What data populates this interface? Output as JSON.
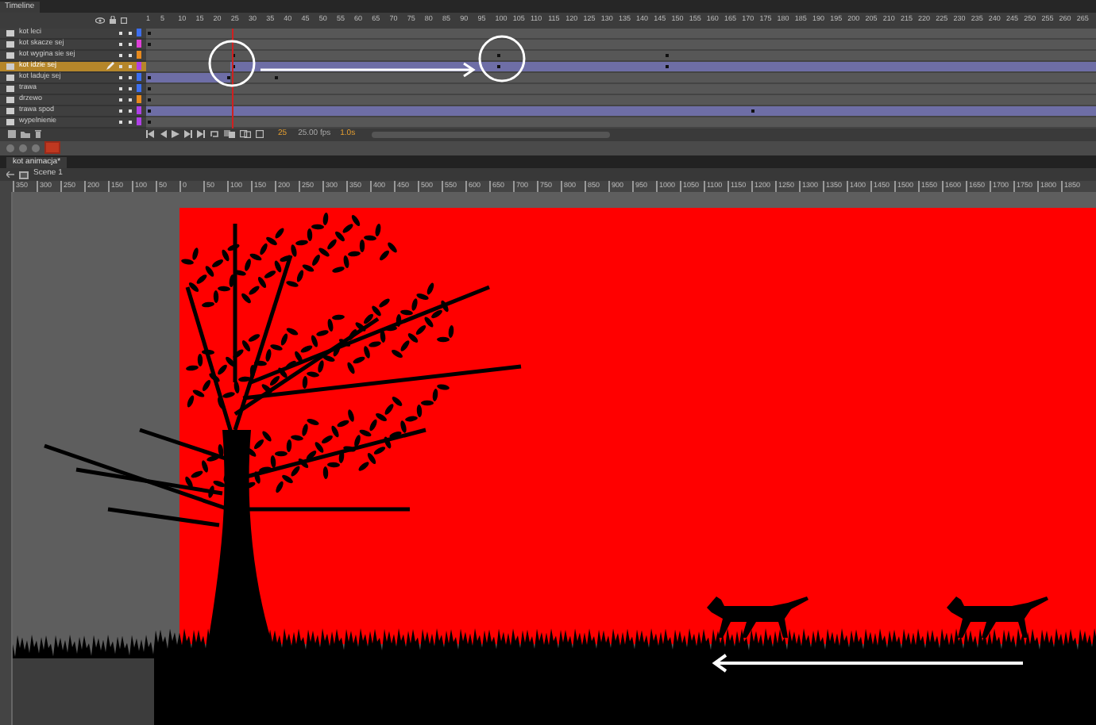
{
  "timeline": {
    "title": "Timeline",
    "frame_ruler": [
      "1",
      "5",
      "10",
      "15",
      "20",
      "25",
      "30",
      "35",
      "40",
      "45",
      "50",
      "55",
      "60",
      "65",
      "70",
      "75",
      "80",
      "85",
      "90",
      "95",
      "100",
      "105",
      "110",
      "115",
      "120",
      "125",
      "130",
      "135",
      "140",
      "145",
      "150",
      "155",
      "160",
      "165",
      "170",
      "175",
      "180",
      "185",
      "190",
      "195",
      "200",
      "205",
      "210",
      "215",
      "220",
      "225",
      "230",
      "235",
      "240",
      "245",
      "250",
      "255",
      "260",
      "265"
    ],
    "layers": [
      {
        "name": "kot leci",
        "color": "#3d6ff0",
        "selected": false,
        "kind": "empty"
      },
      {
        "name": "kot skacze sej",
        "color": "#e040d8",
        "selected": false,
        "kind": "empty"
      },
      {
        "name": "kot wygina sie sej",
        "color": "#e88a1c",
        "selected": false,
        "kind": "keys"
      },
      {
        "name": "kot idzie sej",
        "color": "#b040e8",
        "selected": true,
        "kind": "tween-after"
      },
      {
        "name": "kot laduje sej",
        "color": "#3d6ff0",
        "selected": false,
        "kind": "tween-before"
      },
      {
        "name": "trawa",
        "color": "#3d6ff0",
        "selected": false,
        "kind": "static"
      },
      {
        "name": "drzewo",
        "color": "#e88a1c",
        "selected": false,
        "kind": "static"
      },
      {
        "name": "trawa spod",
        "color": "#b040e8",
        "selected": false,
        "kind": "tween-full"
      },
      {
        "name": "wypelnienie",
        "color": "#b040e8",
        "selected": false,
        "kind": "static"
      }
    ],
    "status": {
      "frame": "25",
      "fps": "25.00 fps",
      "time": "1.0s"
    }
  },
  "document": {
    "tab": "kot animacja*",
    "scene": "Scene 1",
    "stage_ruler": [
      "350",
      "300",
      "250",
      "200",
      "150",
      "100",
      "50",
      "0",
      "50",
      "100",
      "150",
      "200",
      "250",
      "300",
      "350",
      "400",
      "450",
      "500",
      "550",
      "600",
      "650",
      "700",
      "750",
      "800",
      "850",
      "900",
      "950",
      "1000",
      "1050",
      "1100",
      "1150",
      "1200",
      "1250",
      "1300",
      "1350",
      "1400",
      "1450",
      "1500",
      "1550",
      "1600",
      "1650",
      "1700",
      "1750",
      "1800",
      "1850"
    ]
  }
}
